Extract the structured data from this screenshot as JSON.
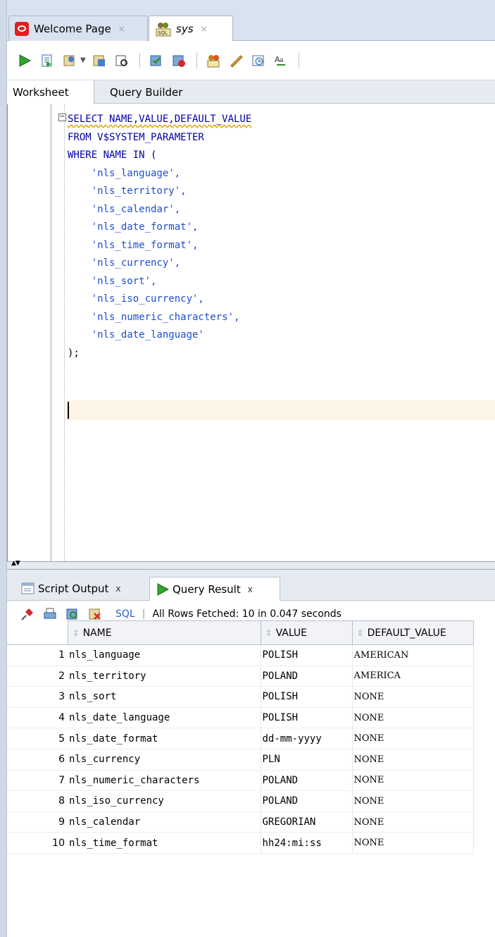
{
  "doc_tabs": [
    {
      "label": "Welcome Page",
      "close": "×"
    },
    {
      "label": "sys",
      "close": "×"
    }
  ],
  "toolbar": {
    "icons": [
      "run-statement-icon",
      "run-script-icon",
      "autotrace-icon",
      "explain-plan-icon",
      "sql-tuning-icon",
      "commit-icon",
      "rollback-icon",
      "unshared-sql-icon",
      "clear-icon",
      "history-icon",
      "format-icon"
    ]
  },
  "editor_tabs": {
    "worksheet": "Worksheet",
    "query_builder": "Query Builder"
  },
  "sql_lines": [
    "SELECT NAME,VALUE,DEFAULT_VALUE",
    "FROM V$SYSTEM_PARAMETER",
    "WHERE NAME IN (",
    "    'nls_language',",
    "    'nls_territory',",
    "    'nls_calendar',",
    "    'nls_date_format',",
    "    'nls_time_format',",
    "    'nls_currency',",
    "    'nls_sort',",
    "    'nls_iso_currency',",
    "    'nls_numeric_characters',",
    "    'nls_date_language'",
    ");"
  ],
  "output_tabs": {
    "script_output": "Script Output",
    "query_result": "Query Result",
    "close": "x"
  },
  "result_toolbar": {
    "sql": "SQL",
    "separator": "|",
    "status": "All Rows Fetched: 10 in 0.047 seconds"
  },
  "grid": {
    "columns": [
      "NAME",
      "VALUE",
      "DEFAULT_VALUE"
    ],
    "rows": [
      {
        "n": "1",
        "name": "nls_language",
        "value": "POLISH",
        "default": "AMERICAN"
      },
      {
        "n": "2",
        "name": "nls_territory",
        "value": "POLAND",
        "default": "AMERICA"
      },
      {
        "n": "3",
        "name": "nls_sort",
        "value": "POLISH",
        "default": "NONE"
      },
      {
        "n": "4",
        "name": "nls_date_language",
        "value": "POLISH",
        "default": "NONE"
      },
      {
        "n": "5",
        "name": "nls_date_format",
        "value": "dd-mm-yyyy",
        "default": "NONE"
      },
      {
        "n": "6",
        "name": "nls_currency",
        "value": "PLN",
        "default": "NONE"
      },
      {
        "n": "7",
        "name": "nls_numeric_characters",
        "value": "POLAND",
        "default": "NONE"
      },
      {
        "n": "8",
        "name": "nls_iso_currency",
        "value": "POLAND",
        "default": "NONE"
      },
      {
        "n": "9",
        "name": "nls_calendar",
        "value": "GREGORIAN",
        "default": "NONE"
      },
      {
        "n": "10",
        "name": "nls_time_format",
        "value": "hh24:mi:ss",
        "default": "NONE"
      }
    ]
  }
}
